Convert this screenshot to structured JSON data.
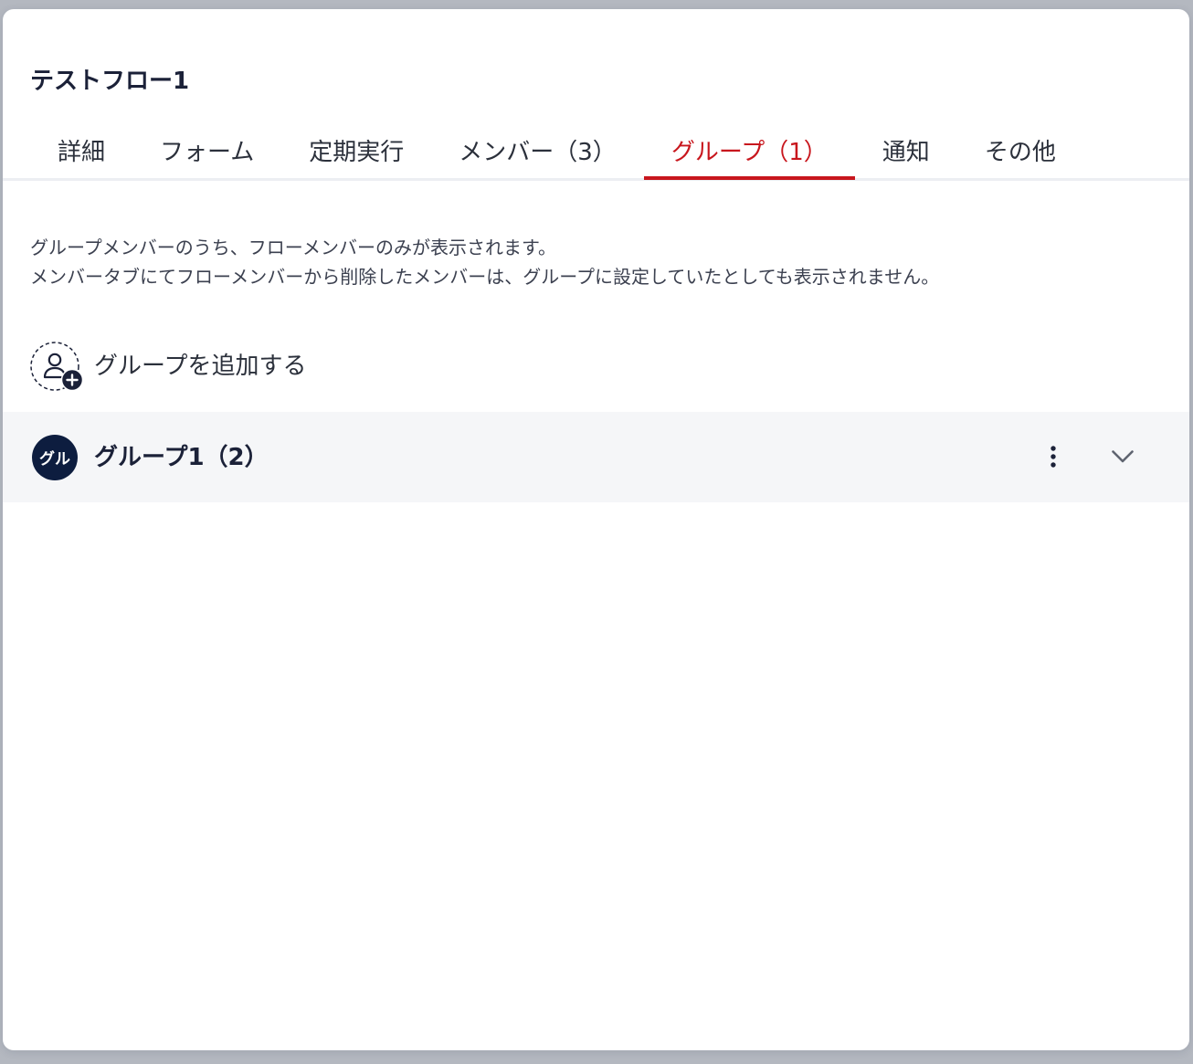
{
  "dialog": {
    "title": "テストフロー1",
    "tabs": [
      {
        "label": "詳細",
        "active": false
      },
      {
        "label": "フォーム",
        "active": false
      },
      {
        "label": "定期実行",
        "active": false
      },
      {
        "label": "メンバー（3）",
        "active": false
      },
      {
        "label": "グループ（1）",
        "active": true
      },
      {
        "label": "通知",
        "active": false
      },
      {
        "label": "その他",
        "active": false
      }
    ],
    "description": [
      "グループメンバーのうち、フローメンバーのみが表示されます。",
      "メンバータブにてフローメンバーから削除したメンバーは、グループに設定していたとしても表示されません。"
    ],
    "add_group": {
      "label": "グループを追加する",
      "icon": "add-person-icon"
    },
    "groups": [
      {
        "avatar_text": "グル",
        "name": "グループ1（2）",
        "menu_icon": "more-vertical-icon",
        "expand_icon": "chevron-down-icon",
        "expanded": false
      }
    ]
  },
  "colors": {
    "accent": "#c8161d",
    "text_primary": "#1b2138",
    "avatar_bg": "#0d1d3f",
    "row_bg": "#f5f6f8",
    "overlay": "#b4b8c0"
  }
}
